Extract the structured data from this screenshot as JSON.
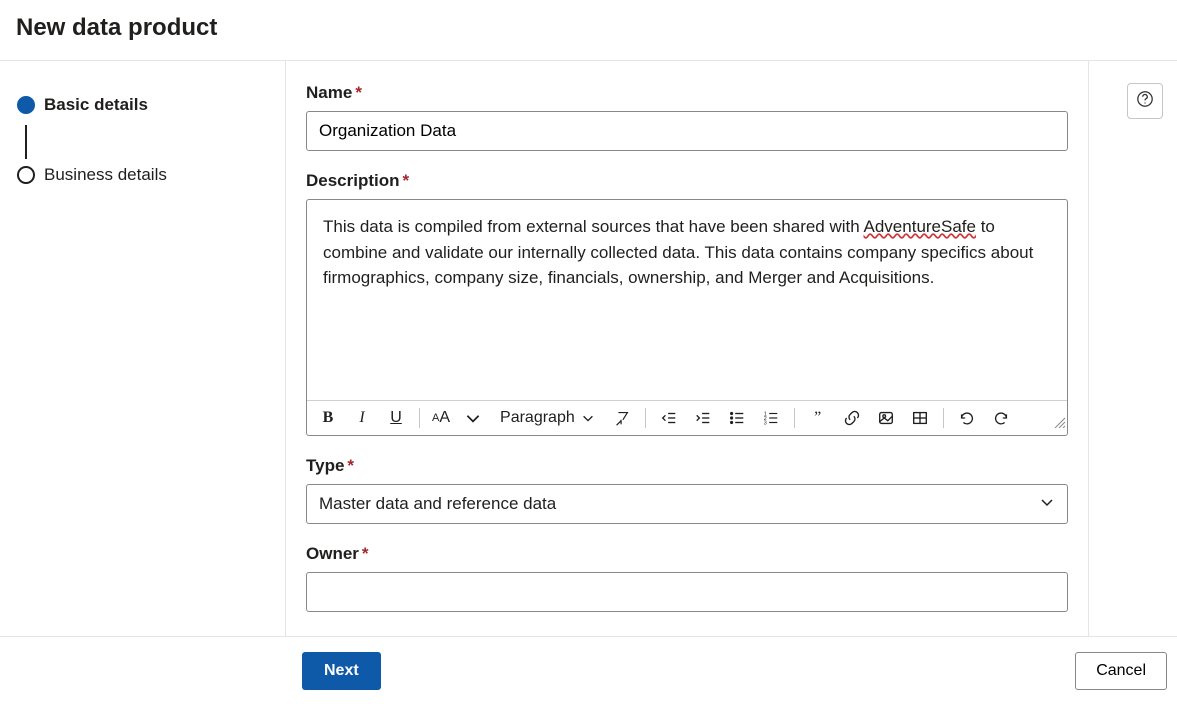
{
  "page_title": "New data product",
  "steps": [
    {
      "label": "Basic details",
      "active": true
    },
    {
      "label": "Business details",
      "active": false
    }
  ],
  "fields": {
    "name": {
      "label": "Name",
      "value": "Organization Data",
      "required": true
    },
    "description": {
      "label": "Description",
      "required": true,
      "value_pre": "This data is compiled from external sources that have been shared with ",
      "spellcheck_word": "AdventureSafe",
      "value_post": " to combine and validate our internally collected data.  This data contains company specifics about firmographics, company size, financials, ownership, and Merger and Acquisitions."
    },
    "type": {
      "label": "Type",
      "required": true,
      "selected": "Master data and reference data"
    },
    "owner": {
      "label": "Owner",
      "required": true,
      "value": ""
    }
  },
  "toolbar": {
    "paragraph_label": "Paragraph"
  },
  "buttons": {
    "next": "Next",
    "cancel": "Cancel"
  },
  "required_marker": "*"
}
